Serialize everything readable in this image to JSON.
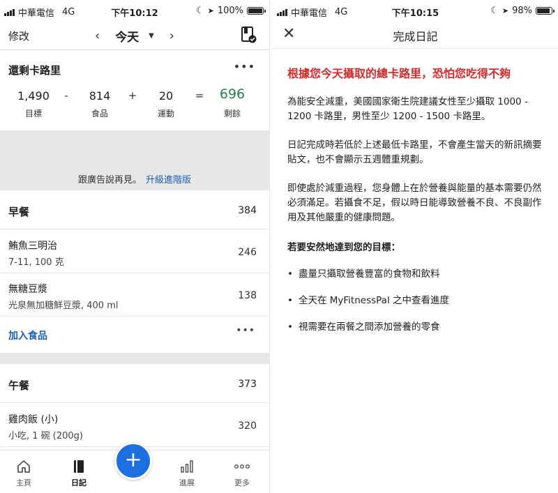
{
  "left_status": {
    "carrier": "中華電信",
    "network": "4G",
    "time": "下午10:12",
    "battery": "100%",
    "battery_level": 1.0
  },
  "right_status": {
    "carrier": "中華電信",
    "network": "4G",
    "time": "下午10:15",
    "battery": "98%",
    "battery_level": 0.98
  },
  "nav": {
    "edit": "修改",
    "title": "今天",
    "prev": "‹",
    "next": "›"
  },
  "remaining": {
    "title": "還剩卡路里",
    "more": "•••",
    "goal": {
      "value": "1,490",
      "label": "目標"
    },
    "food": {
      "value": "814",
      "label": "食品"
    },
    "exercise": {
      "value": "20",
      "label": "運動"
    },
    "remain": {
      "value": "696",
      "label": "剩餘"
    },
    "ops": {
      "minus": "-",
      "plus": "+",
      "equals": "="
    }
  },
  "ad": {
    "text": "跟廣告說再見。",
    "link": "升級進階版"
  },
  "breakfast": {
    "title": "早餐",
    "total": "384",
    "items": [
      {
        "name": "鮪魚三明治",
        "desc": "7-11, 100 克",
        "cal": "246"
      },
      {
        "name": "無糖豆漿",
        "desc": "光泉無加糖鮮豆漿, 400 ml",
        "cal": "138"
      }
    ],
    "add": "加入食品",
    "more": "•••"
  },
  "lunch": {
    "title": "午餐",
    "total": "373",
    "items": [
      {
        "name": "雞肉飯 (小)",
        "desc": "小吃, 1 碗 (200g)",
        "cal": "320"
      }
    ]
  },
  "tabs": {
    "home": "主頁",
    "diary": "日記",
    "plus": "+",
    "progress": "進展",
    "more": "更多"
  },
  "complete": {
    "close": "✕",
    "title": "完成日記",
    "headline": "根據您今天攝取的總卡路里，恐怕您吃得不夠",
    "para1": "為能安全減重，美國國家衛生院建議女性至少攝取 1000 - 1200 卡路里，男性至少 1200 - 1500 卡路里。",
    "para2": "日記完成時若低於上述最低卡路里，不會產生當天的新訊摘要貼文，也不會顯示五週體重規劃。",
    "para3": "即使處於減重過程，您身體上在於營養與能量的基本需要仍然必須滿足。若攝食不足，假以時日能導致營養不良、不良副作用及其他嚴重的健康問題。",
    "subtitle": "若要安然地達到您的目標：",
    "bullets": [
      "盡量只攝取營養豐富的食物和飲料",
      "全天在 MyFitnessPal 之中查看進度",
      "視需要在兩餐之間添加營養的零食"
    ]
  },
  "colors": {
    "accent": "#1b6fe0",
    "link": "#1a5fb4",
    "remaining_green": "#2e7d4f",
    "warning_red": "#d12c2c"
  }
}
